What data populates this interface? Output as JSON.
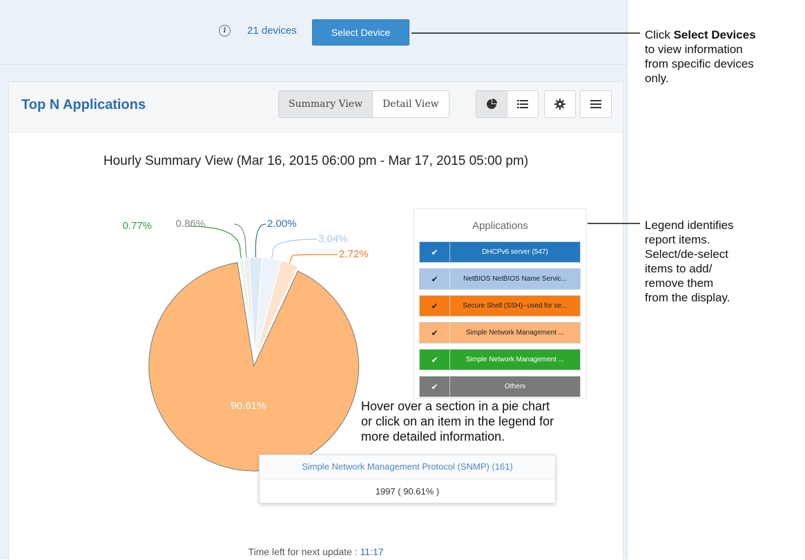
{
  "device_bar": {
    "info_icon": "info-icon",
    "device_count": "21 devices",
    "select_device_label": "Select Device"
  },
  "card": {
    "title": "Top N Applications",
    "views": [
      "Summary View",
      "Detail View"
    ],
    "active_view": "Summary View",
    "toolbar_icons": [
      "pie-chart-icon",
      "list-view-icon",
      "gear-icon",
      "menu-icon"
    ]
  },
  "chart": {
    "title": "Hourly Summary View (Mar 16, 2015 06:00 pm - Mar 17, 2015 05:00 pm)"
  },
  "chart_data": {
    "type": "pie",
    "title": "Hourly Summary View (Mar 16, 2015 06:00 pm - Mar 17, 2015 05:00 pm)",
    "slices": [
      {
        "label": "Simple Network Management Protocol (SNMP) (161)",
        "percent": 90.61,
        "display": "90.61%",
        "color": "#fdb87a",
        "text_color": "#ffffff"
      },
      {
        "label": "Simple Network Management ...",
        "percent": 0.77,
        "display": "0.77%",
        "color": "#e8f5e8",
        "text_color": "#3a9a3a"
      },
      {
        "label": "Others",
        "percent": 0.86,
        "display": "0.86%",
        "color": "#eeeeee",
        "text_color": "#888888"
      },
      {
        "label": "DHCPv6 server (547)",
        "percent": 2.0,
        "display": "2.00%",
        "color": "#dce9f6",
        "text_color": "#2a6db0"
      },
      {
        "label": "NetBIOS NetBIOS Name Servic...",
        "percent": 3.04,
        "display": "3.04%",
        "color": "#edf3fa",
        "text_color": "#a9c6e8"
      },
      {
        "label": "Secure Shell (SSH)--used for se...",
        "percent": 2.72,
        "display": "2.72%",
        "color": "#fde2cc",
        "text_color": "#f07a22"
      }
    ]
  },
  "legend": {
    "title": "Applications",
    "items": [
      {
        "label": "DHCPv6 server (547)",
        "bg": "#2377bd",
        "fg": "#ffffff",
        "check": "✔"
      },
      {
        "label": "NetBIOS NetBIOS Name Servic...",
        "bg": "#a9c6e6",
        "fg": "#222222",
        "check": "✔"
      },
      {
        "label": "Secure Shell (SSH)--used for se...",
        "bg": "#f57c14",
        "fg": "#222222",
        "check": "✔"
      },
      {
        "label": "Simple Network Management ...",
        "bg": "#fcb47a",
        "fg": "#222222",
        "check": "✔"
      },
      {
        "label": "Simple Network Management ...",
        "bg": "#2ea62e",
        "fg": "#ffffff",
        "check": "✔"
      },
      {
        "label": "Others",
        "bg": "#7a7a7a",
        "fg": "#ffffff",
        "check": "✔"
      }
    ]
  },
  "tooltip": {
    "title": "Simple Network Management Protocol (SNMP) (161)",
    "value": "1997 ( 90.61% )"
  },
  "footer": {
    "label": "Time left for next update : ",
    "value": "11:17"
  },
  "annotations": {
    "select_prefix": "Click ",
    "select_bold": "Select Devices",
    "select_lines": [
      "to view information",
      "from specific devices",
      "only."
    ],
    "legend_lines": [
      "Legend identifies",
      "report items.",
      "Select/de-select",
      "items to add/",
      "remove them",
      "from the display."
    ],
    "hover_lines": [
      "Hover over a section in a pie chart",
      "or click on an item in the legend for",
      "more detailed information."
    ]
  }
}
